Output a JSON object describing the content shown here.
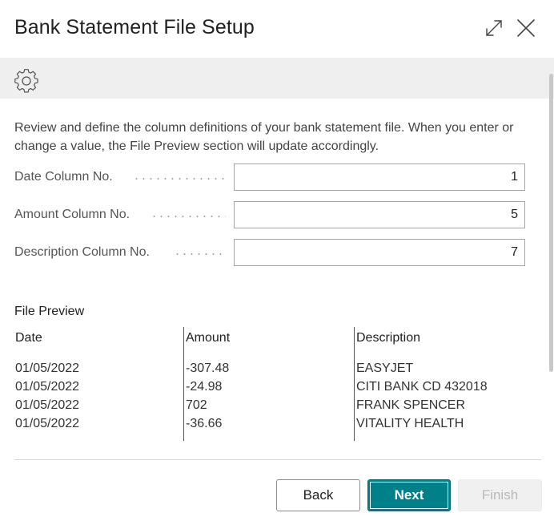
{
  "dialog": {
    "title": "Bank Statement File Setup"
  },
  "intro_text": "Review and define the column definitions of your bank statement file. When you enter or change a value, the File Preview section will update accordingly.",
  "fields": [
    {
      "label": "Date Column No.",
      "value": "1"
    },
    {
      "label": "Amount Column No.",
      "value": "5"
    },
    {
      "label": "Description Column No.",
      "value": "7"
    }
  ],
  "preview": {
    "title": "File Preview",
    "headers": [
      "Date",
      "Amount",
      "Description"
    ],
    "rows": [
      [
        "01/05/2022",
        "-307.48",
        "EASYJET"
      ],
      [
        "01/05/2022",
        "-24.98",
        "CITI BANK CD 432018"
      ],
      [
        "01/05/2022",
        "702",
        "FRANK SPENCER"
      ],
      [
        "01/05/2022",
        "-36.66",
        "VITALITY HEALTH"
      ]
    ]
  },
  "buttons": {
    "back": "Back",
    "next": "Next",
    "finish": "Finish"
  },
  "icons": {
    "expand": "expand-icon",
    "close": "close-icon",
    "settings": "gear-icon"
  },
  "colors": {
    "accent": "#00818a",
    "toolbar": "#efefef"
  }
}
